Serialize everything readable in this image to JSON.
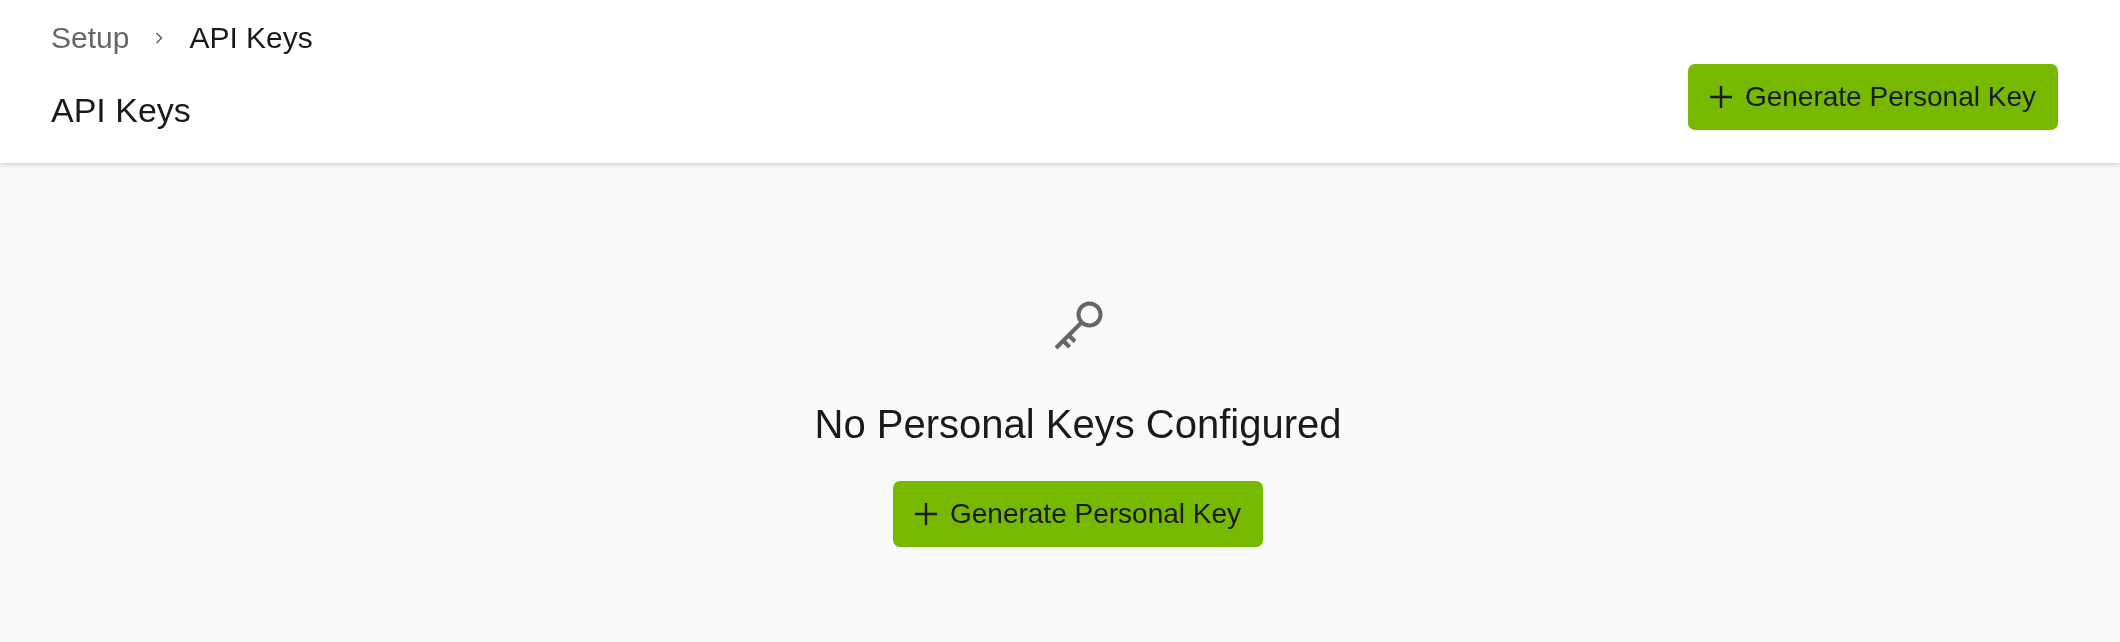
{
  "breadcrumb": [
    {
      "label": "Setup",
      "current": false
    },
    {
      "label": "API Keys",
      "current": true
    }
  ],
  "header": {
    "title": "API Keys",
    "action": {
      "label": "Generate Personal Key"
    }
  },
  "empty_state": {
    "message": "No Personal Keys Configured",
    "action": {
      "label": "Generate Personal Key"
    }
  }
}
